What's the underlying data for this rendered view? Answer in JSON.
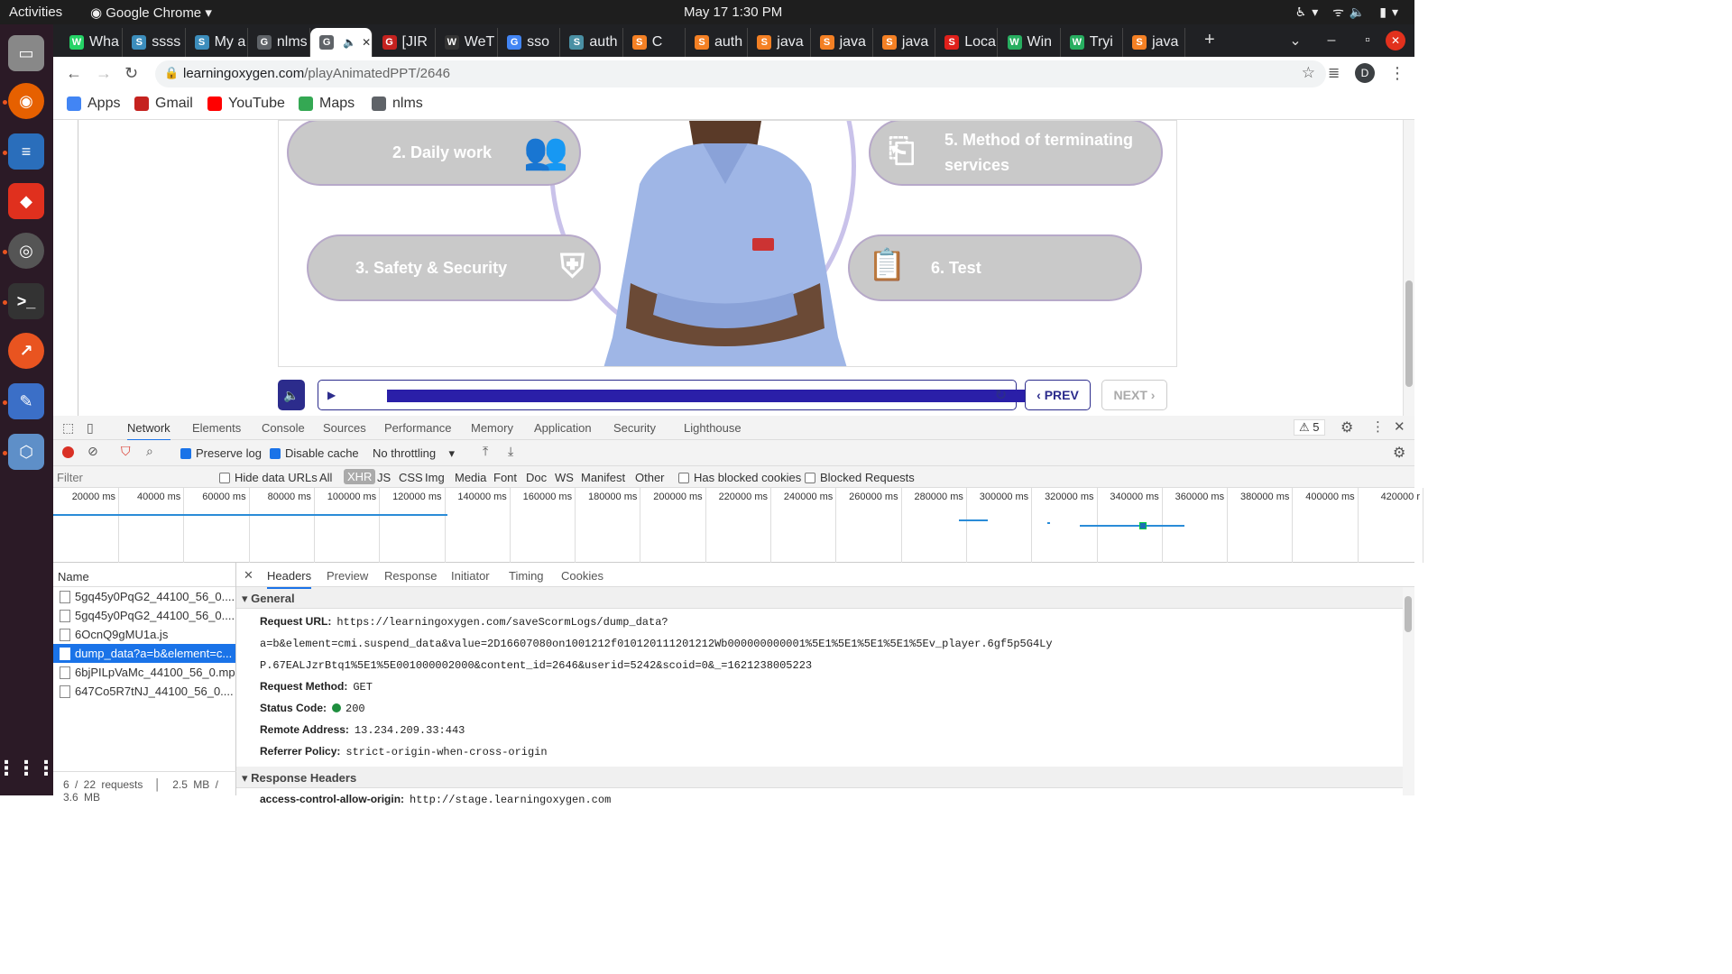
{
  "os": {
    "activities": "Activities",
    "app_name": "Google Chrome",
    "clock": "May 17  1:30 PM"
  },
  "tabs": [
    {
      "label": "Wha",
      "fav": "whatsapp-icon",
      "color": "#25d366"
    },
    {
      "label": "ssss",
      "fav": "s-icon",
      "color": "#3c8dbc"
    },
    {
      "label": "My a",
      "fav": "s-icon",
      "color": "#3c8dbc"
    },
    {
      "label": "nlms",
      "fav": "globe-icon",
      "color": "#5f6368"
    },
    {
      "label": "",
      "fav": "globe-icon",
      "color": "#5f6368"
    },
    {
      "label": "[JIR",
      "fav": "gmail-icon",
      "color": "#c5221f"
    },
    {
      "label": "WeT",
      "fav": "wetransfer-icon",
      "color": "#333"
    },
    {
      "label": "sso",
      "fav": "google-icon",
      "color": "#4285f4"
    },
    {
      "label": "auth",
      "fav": "shield-icon",
      "color": "#4a90a4"
    },
    {
      "label": "C",
      "fav": "stackoverflow-icon",
      "color": "#f48024"
    },
    {
      "label": "auth",
      "fav": "stackoverflow-icon",
      "color": "#f48024"
    },
    {
      "label": "java",
      "fav": "stackoverflow-icon",
      "color": "#f48024"
    },
    {
      "label": "java",
      "fav": "stackoverflow-icon",
      "color": "#f48024"
    },
    {
      "label": "java",
      "fav": "stackoverflow-icon",
      "color": "#f48024"
    },
    {
      "label": "Loca",
      "fav": "s-red-icon",
      "color": "#e0201b"
    },
    {
      "label": "Win",
      "fav": "w-icon",
      "color": "#27ae60"
    },
    {
      "label": "Tryi",
      "fav": "w-icon",
      "color": "#27ae60"
    },
    {
      "label": "java",
      "fav": "stackoverflow-icon",
      "color": "#f48024"
    }
  ],
  "omnibar": {
    "host": "learningoxygen.com",
    "path": "/playAnimatedPPT/2646",
    "profile_initial": "D"
  },
  "bookmarks": [
    {
      "label": "Apps",
      "icon": "apps-grid-icon",
      "color": "#4285f4"
    },
    {
      "label": "Gmail",
      "icon": "gmail-icon",
      "color": "#c5221f"
    },
    {
      "label": "YouTube",
      "icon": "youtube-icon",
      "color": "#ff0000"
    },
    {
      "label": "Maps",
      "icon": "maps-icon",
      "color": "#34a853"
    },
    {
      "label": "nlms",
      "icon": "globe-icon",
      "color": "#5f6368"
    }
  ],
  "slide": {
    "items": [
      {
        "label": "2. Daily work",
        "icon": "people-icon"
      },
      {
        "label": "5. Method of terminating services",
        "icon": "exit-door-icon"
      },
      {
        "label": "3. Safety & Security",
        "icon": "shield-check-icon"
      },
      {
        "label": "6. Test",
        "icon": "clipboard-icon"
      }
    ],
    "prev_label": "PREV",
    "next_label": "NEXT",
    "progress": 1.0
  },
  "devtools": {
    "main_tabs": [
      "Network",
      "Elements",
      "Console",
      "Sources",
      "Performance",
      "Memory",
      "Application",
      "Security",
      "Lighthouse"
    ],
    "warnings": "5",
    "preserve_log": "Preserve log",
    "disable_cache": "Disable cache",
    "throttling": "No throttling",
    "filter_placeholder": "Filter",
    "hide_data_urls": "Hide data URLs",
    "type_filters": [
      "All",
      "XHR",
      "JS",
      "CSS",
      "Img",
      "Media",
      "Font",
      "Doc",
      "WS",
      "Manifest",
      "Other"
    ],
    "has_blocked_cookies": "Has blocked cookies",
    "blocked_requests": "Blocked Requests",
    "timeline_ticks": [
      "20000 ms",
      "40000 ms",
      "60000 ms",
      "80000 ms",
      "100000 ms",
      "120000 ms",
      "140000 ms",
      "160000 ms",
      "180000 ms",
      "200000 ms",
      "220000 ms",
      "240000 ms",
      "260000 ms",
      "280000 ms",
      "300000 ms",
      "320000 ms",
      "340000 ms",
      "360000 ms",
      "380000 ms",
      "400000 ms",
      "420000 r"
    ],
    "name_header": "Name",
    "requests": [
      "5gq45y0PqG2_44100_56_0....",
      "5gq45y0PqG2_44100_56_0....",
      "6OcnQ9gMU1a.js",
      "dump_data?a=b&element=c...",
      "6bjPILpVaMc_44100_56_0.mp3",
      "647Co5R7tNJ_44100_56_0...."
    ],
    "selected_request": 3,
    "footer_requests": "6 / 22 requests",
    "footer_size": "2.5 MB / 3.6 MB",
    "detail_tabs": [
      "Headers",
      "Preview",
      "Response",
      "Initiator",
      "Timing",
      "Cookies"
    ],
    "general_title": "General",
    "general": [
      {
        "k": "Request URL:",
        "v": "https://learningoxygen.com/saveScormLogs/dump_data?a=b&element=cmi.suspend_data&value=2D16607080on1001212f010120111201212Wb000000000001%5E1%5E1%5E1%5E1%5Ev_player.6gf5p5G4Ly"
      },
      {
        "k": "",
        "v": "P.67EALJzrBtq1%5E1%5E001000002000&content_id=2646&userid=5242&scoid=0&_=1621238005223"
      },
      {
        "k": "Request Method:",
        "v": "GET"
      },
      {
        "k": "Status Code:",
        "v": "200"
      },
      {
        "k": "Remote Address:",
        "v": "13.234.209.33:443"
      },
      {
        "k": "Referrer Policy:",
        "v": "strict-origin-when-cross-origin"
      }
    ],
    "response_title": "Response Headers",
    "response": [
      {
        "k": "access-control-allow-origin:",
        "v": "http://stage.learningoxygen.com"
      }
    ]
  }
}
